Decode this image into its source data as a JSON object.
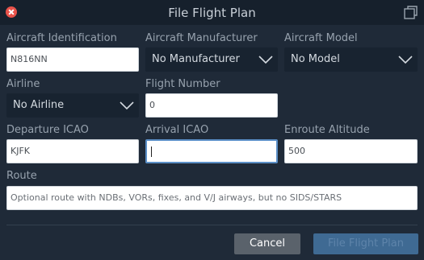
{
  "window": {
    "title": "File Flight Plan"
  },
  "labels": {
    "aircraft_id": "Aircraft Identification",
    "manufacturer": "Aircraft Manufacturer",
    "model": "Aircraft Model",
    "airline": "Airline",
    "flight_number": "Flight Number",
    "departure": "Departure ICAO",
    "arrival": "Arrival ICAO",
    "altitude": "Enroute Altitude",
    "route": "Route"
  },
  "values": {
    "aircraft_id": "N816NN",
    "flight_number": "0",
    "departure": "KJFK",
    "arrival": "",
    "altitude": "500"
  },
  "placeholders": {
    "route": "Optional route with NDBs, VORs, fixes, and V/J airways, but no SIDS/STARS"
  },
  "selects": {
    "manufacturer": "No Manufacturer",
    "model": "No Model",
    "airline": "No Airline"
  },
  "buttons": {
    "cancel": "Cancel",
    "submit": "File Flight Plan"
  },
  "icons": {
    "close": "close-icon",
    "popout": "popout-window-icon",
    "chevron": "chevron-down-icon"
  },
  "colors": {
    "background": "#1f2a38",
    "titlebar": "#16202c",
    "close": "#e8524a",
    "focus_border": "#5b8fc7",
    "submit_disabled": "#3f6a93"
  }
}
